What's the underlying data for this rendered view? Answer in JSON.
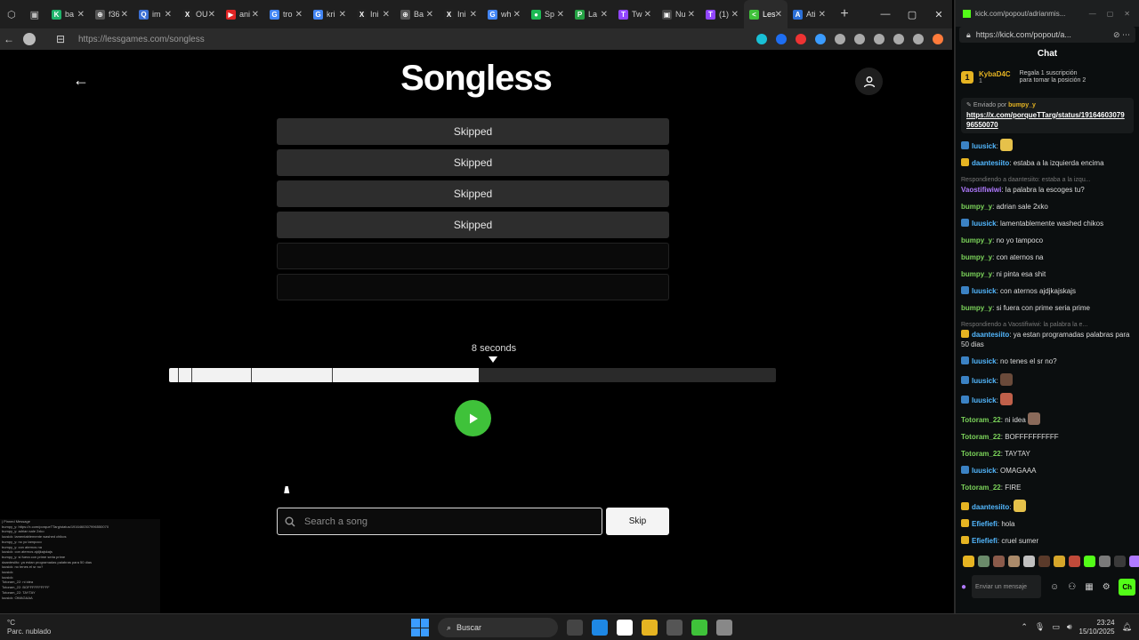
{
  "browser": {
    "tabs": [
      {
        "label": "ba",
        "color": "#1fb36b",
        "glyph": "K"
      },
      {
        "label": "f36",
        "color": "#555555",
        "glyph": "⊕"
      },
      {
        "label": "im",
        "color": "#3b6fd4",
        "glyph": "Q"
      },
      {
        "label": "OU",
        "color": "#222222",
        "glyph": "X"
      },
      {
        "label": "ani",
        "color": "#e02424",
        "glyph": "▶"
      },
      {
        "label": "tro",
        "color": "#4285f4",
        "glyph": "G"
      },
      {
        "label": "kri",
        "color": "#4285f4",
        "glyph": "G"
      },
      {
        "label": "Ini",
        "color": "#222222",
        "glyph": "X"
      },
      {
        "label": "Ba",
        "color": "#555555",
        "glyph": "⊕"
      },
      {
        "label": "Ini",
        "color": "#222222",
        "glyph": "X"
      },
      {
        "label": "wh",
        "color": "#4285f4",
        "glyph": "G"
      },
      {
        "label": "Sp",
        "color": "#1db954",
        "glyph": "●"
      },
      {
        "label": "La",
        "color": "#25a244",
        "glyph": "P"
      },
      {
        "label": "Tw",
        "color": "#9146ff",
        "glyph": "T"
      },
      {
        "label": "Nu",
        "color": "#444444",
        "glyph": "▣"
      },
      {
        "label": "(1)",
        "color": "#9146ff",
        "glyph": "T"
      },
      {
        "label": "Les",
        "color": "#3fc23a",
        "glyph": "<",
        "active": true
      },
      {
        "label": "Ati",
        "color": "#2b6fd6",
        "glyph": "A"
      }
    ],
    "url": "https://lessgames.com/songless",
    "toolbar_icon_colors": [
      "#19c0d6",
      "#1e6ef2",
      "#e33",
      "#3b9cff",
      "#aaa",
      "#aaa",
      "#aaa",
      "#aaa",
      "#aaa",
      "#ff7b3b"
    ]
  },
  "game": {
    "logo": "Songless",
    "guesses": [
      {
        "text": "Skipped",
        "state": "filled"
      },
      {
        "text": "Skipped",
        "state": "filled"
      },
      {
        "text": "Skipped",
        "state": "filled"
      },
      {
        "text": "Skipped",
        "state": "filled"
      },
      {
        "text": "",
        "state": "empty"
      },
      {
        "text": "",
        "state": "empty"
      }
    ],
    "seconds_label": "8 seconds",
    "progress_fraction": 0.51,
    "tick_fractions": [
      0.015,
      0.036,
      0.135,
      0.269
    ],
    "play_color": "#3fc23a",
    "search_placeholder": "Search a song",
    "skip_label": "Skip"
  },
  "mini_chat": [
    "| Pinned Message",
    "bumpy_y: https://x.com/porqueTTarg/status/1916460307996550070",
    "bumpy_y: adrian sale 2xko",
    "luusick: lamentablemente washed chikos",
    "bumpy_y: no yo tampoco",
    "bumpy_y: con aternos na",
    "luusick: con aternos ajdjkajskajs",
    "bumpy_y: si fuera con prime seria prime",
    "daantesiito: ya estan programadas palabras para 50 dias",
    "luusick: no tenes el sr no?",
    "luusick:",
    "luusick:",
    "Totoram_22: ni idea",
    "Totoram_22: BOFFFFFFFFFF",
    "Totoram_22: TAYTAY",
    "luusick: OMAGAAA"
  ],
  "kick": {
    "url": "https://kick.com/popout/a...",
    "title_url": "kick.com/popout/adrianmis...",
    "chat_title": "Chat",
    "gift": {
      "user": "KybaD4C",
      "count": "1",
      "text": "Regala 1 suscripción para tomar la posición 2"
    },
    "pinned": {
      "by_prefix": "Enviado por",
      "by_user": "bumpy_y",
      "link": "https://x.com/porqueTTarg/status/1916460307996550070"
    },
    "messages": [
      {
        "user": "luusick",
        "text": "",
        "color": "#53b8ff",
        "badge": "#3b82c4",
        "emote": "#e6c14a"
      },
      {
        "user": "daantesiito",
        "text": "estaba a la izquierda encima",
        "color": "#53b8ff",
        "badge": "#e6b422"
      },
      {
        "reply": "Respondiendo a daantesiito: estaba a la izqu...",
        "user": "Vaostifiwiwi",
        "text": "la palabra la escoges tu?",
        "color": "#b07aff"
      },
      {
        "user": "bumpy_y",
        "text": "adrian sale 2xko",
        "color": "#7bd35a"
      },
      {
        "user": "luusick",
        "text": "lamentablemente washed chikos",
        "color": "#53b8ff",
        "badge": "#3b82c4"
      },
      {
        "user": "bumpy_y",
        "text": "no yo tampoco",
        "color": "#7bd35a"
      },
      {
        "user": "bumpy_y",
        "text": "con aternos na",
        "color": "#7bd35a"
      },
      {
        "user": "bumpy_y",
        "text": "ni pinta esa shit",
        "color": "#7bd35a"
      },
      {
        "user": "luusick",
        "text": "con aternos ajdjkajskajs",
        "color": "#53b8ff",
        "badge": "#3b82c4"
      },
      {
        "user": "bumpy_y",
        "text": "si fuera con prime seria prime",
        "color": "#7bd35a"
      },
      {
        "reply": "Respondiendo a Vaostifiwiwi: la palabra la e...",
        "user": "daantesiito",
        "text": "ya estan programadas palabras para 50 dias",
        "color": "#53b8ff",
        "badge": "#e6b422"
      },
      {
        "user": "luusick",
        "text": "no tenes el sr no?",
        "color": "#53b8ff",
        "badge": "#3b82c4"
      },
      {
        "user": "luusick",
        "text": "",
        "color": "#53b8ff",
        "badge": "#3b82c4",
        "emote": "#6a4a3a"
      },
      {
        "user": "luusick",
        "text": "",
        "color": "#53b8ff",
        "badge": "#3b82c4",
        "emote": "#c0604a"
      },
      {
        "user": "Totoram_22",
        "text": "ni idea",
        "color": "#7bd35a",
        "emote": "#8a6a5a"
      },
      {
        "user": "Totoram_22",
        "text": "BOFFFFFFFFFF",
        "color": "#7bd35a"
      },
      {
        "user": "Totoram_22",
        "text": "TAYTAY",
        "color": "#7bd35a"
      },
      {
        "user": "luusick",
        "text": "OMAGAAA",
        "color": "#53b8ff",
        "badge": "#3b82c4"
      },
      {
        "user": "Totoram_22",
        "text": "FIRE",
        "color": "#7bd35a"
      },
      {
        "user": "daantesiito",
        "text": "",
        "color": "#53b8ff",
        "badge": "#e6b422",
        "emote": "#e6c14a"
      },
      {
        "user": "Efiefiefi",
        "text": "hola",
        "color": "#53b8ff",
        "badge": "#e6b422"
      },
      {
        "user": "Efiefiefi",
        "text": "cruel sumer",
        "color": "#53b8ff",
        "badge": "#e6b422"
      }
    ],
    "emote_colors": [
      "#e6b422",
      "#6a8a6a",
      "#8a5a4a",
      "#aa8a6a",
      "#c0c0c0",
      "#5a3a2a",
      "#d6a62a",
      "#c04a3a",
      "#53fc18",
      "#7a7a7a",
      "#3a3a3a",
      "#b07aff",
      "#d04aa0"
    ],
    "input_placeholder": "Enviar un mensaje",
    "send_label": "Ch"
  },
  "taskbar": {
    "weather_temp": "°C",
    "weather_desc": "Parc. nublado",
    "search_label": "Buscar",
    "app_colors": [
      "#444444",
      "#1e88e5",
      "#ffffff",
      "#e6b422",
      "#555555",
      "#3fc23a",
      "#888888"
    ],
    "time": "23:24",
    "date": "15/10/2025"
  }
}
